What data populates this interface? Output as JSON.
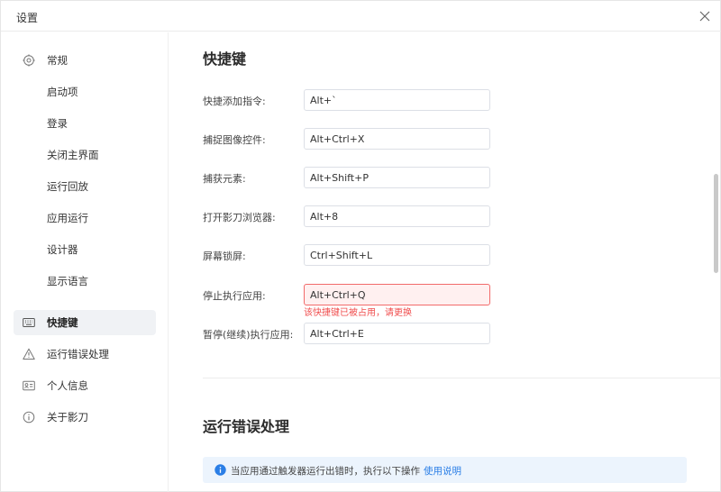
{
  "window": {
    "title": "设置"
  },
  "sidebar": {
    "items": [
      {
        "label": "常规",
        "icon": "gear-icon"
      },
      {
        "label": "启动项"
      },
      {
        "label": "登录"
      },
      {
        "label": "关闭主界面"
      },
      {
        "label": "运行回放"
      },
      {
        "label": "应用运行"
      },
      {
        "label": "设计器"
      },
      {
        "label": "显示语言"
      },
      {
        "label": "快捷键",
        "icon": "keyboard-icon",
        "active": true
      },
      {
        "label": "运行错误处理",
        "icon": "warning-triangle-icon"
      },
      {
        "label": "个人信息",
        "icon": "id-card-icon"
      },
      {
        "label": "关于影刀",
        "icon": "info-circle-icon"
      }
    ]
  },
  "main": {
    "shortcuts": {
      "title": "快捷键",
      "rows": [
        {
          "label": "快捷添加指令:",
          "value": "Alt+`"
        },
        {
          "label": "捕捉图像控件:",
          "value": "Alt+Ctrl+X"
        },
        {
          "label": "捕获元素:",
          "value": "Alt+Shift+P"
        },
        {
          "label": "打开影刀浏览器:",
          "value": "Alt+8"
        },
        {
          "label": "屏幕锁屏:",
          "value": "Ctrl+Shift+L"
        },
        {
          "label": "停止执行应用:",
          "value": "Alt+Ctrl+Q",
          "error": "该快捷键已被占用，请更换"
        },
        {
          "label": "暂停(继续)执行应用:",
          "value": "Alt+Ctrl+E"
        }
      ]
    },
    "error_handling": {
      "title": "运行错误处理",
      "info": "当应用通过触发器运行出错时，执行以下操作",
      "link": "使用说明"
    }
  },
  "colors": {
    "accent_link": "#2a7ee6",
    "error": "#f04e4e",
    "active_nav_bg": "#f0f2f5",
    "info_bg": "#ecf4fd"
  }
}
